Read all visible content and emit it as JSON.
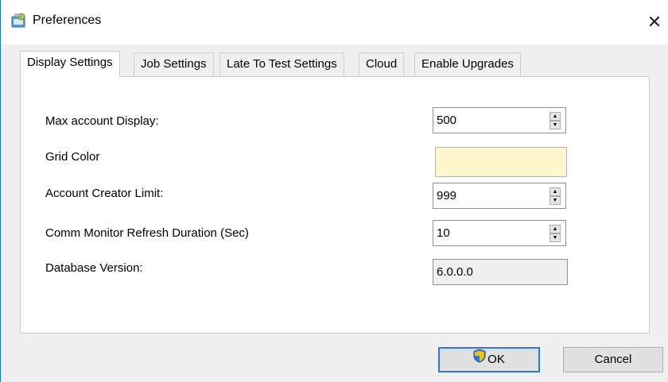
{
  "window": {
    "title": "Preferences",
    "app_icon": "preferences-app-icon",
    "close_symbol": "✕"
  },
  "tabs": [
    {
      "label": "Display Settings",
      "active": true
    },
    {
      "label": "Job Settings",
      "active": false
    },
    {
      "label": "Late To Test Settings",
      "active": false
    },
    {
      "label": "Cloud",
      "active": false
    },
    {
      "label": "Enable Upgrades",
      "active": false
    }
  ],
  "settings": {
    "max_account_display": {
      "label": "Max account Display:",
      "value": "500"
    },
    "grid_color": {
      "label": "Grid Color",
      "color": "#fff7cc"
    },
    "account_creator_limit": {
      "label": "Account Creator Limit:",
      "value": "999"
    },
    "comm_monitor_refresh": {
      "label": "Comm Monitor Refresh Duration (Sec)",
      "value": "10"
    },
    "database_version": {
      "label": "Database Version:",
      "value": "6.0.0.0"
    }
  },
  "buttons": {
    "ok": "OK",
    "cancel": "Cancel"
  },
  "icons": {
    "up_arrow": "▲",
    "down_arrow": "▼"
  }
}
